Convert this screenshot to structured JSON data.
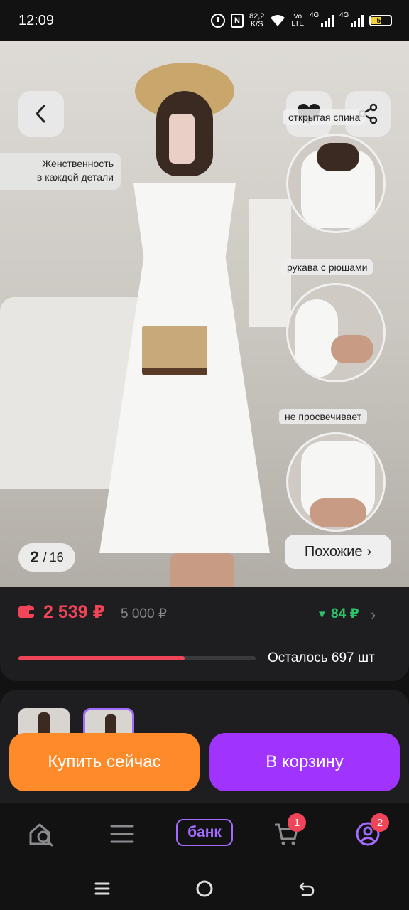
{
  "status_bar": {
    "time": "12:09",
    "net_speed_value": "82,2",
    "net_speed_unit": "K/S",
    "volte_top": "Vo",
    "volte_bottom": "LTE",
    "sim1_label": "4G",
    "sim2_label": "4G",
    "battery_level": "50"
  },
  "gallery": {
    "caption_line1": "Женственность",
    "caption_line2": "в каждой детали",
    "features": [
      {
        "label": "открытая спина"
      },
      {
        "label": "рукава с рюшами"
      },
      {
        "label": "не просвечивает"
      }
    ],
    "counter_current": "2",
    "counter_total": "16",
    "counter_separator": "/",
    "similar_label": "Похожие",
    "similar_chevron": "›"
  },
  "price": {
    "current": "2 539 ₽",
    "old": "5 000 ₽",
    "bonus": "84 ₽",
    "bonus_arrow": "▼",
    "chevron": "›",
    "stock_progress": 0.7,
    "remaining": "Осталось 697 шт"
  },
  "actions": {
    "buy_now": "Купить сейчас",
    "add_to_cart": "В корзину"
  },
  "bottom_nav": {
    "bank_label": "банк",
    "cart_badge": "1",
    "profile_badge": "2"
  },
  "colors": {
    "accent_red": "#f04458",
    "buy_orange": "#ff8a2a",
    "cart_purple": "#a133ff",
    "bonus_green": "#2ec26a"
  }
}
